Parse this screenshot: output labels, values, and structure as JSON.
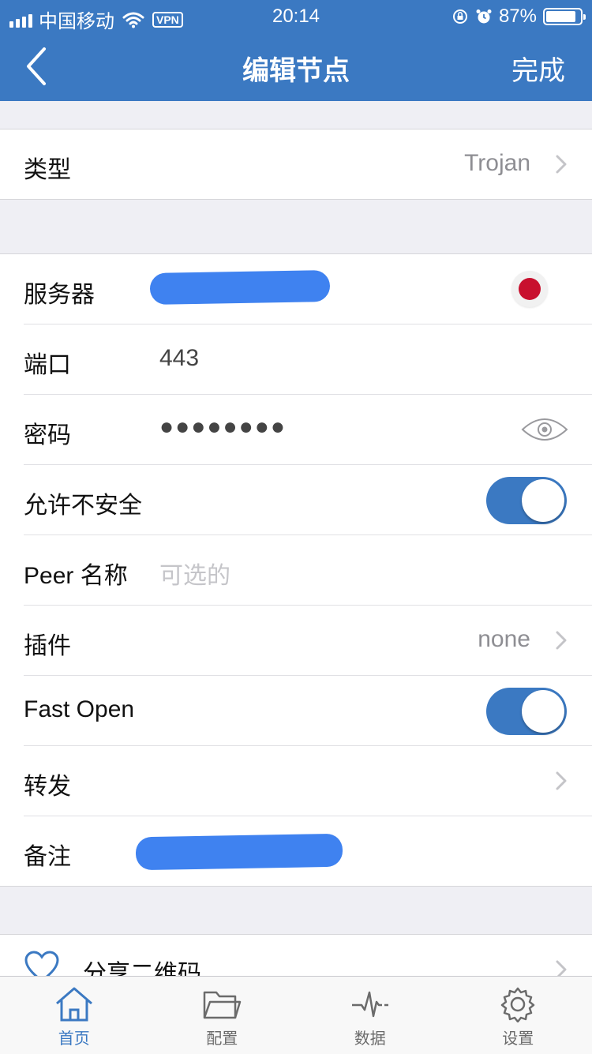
{
  "status_bar": {
    "carrier": "中国移动",
    "vpn": "VPN",
    "time": "20:14",
    "battery": "87%",
    "battery_level": 0.87
  },
  "nav": {
    "back_icon": "chevron-left-icon",
    "title": "编辑节点",
    "done": "完成"
  },
  "type_row": {
    "label": "类型",
    "value": "Trojan"
  },
  "form": {
    "server": {
      "label": "服务器"
    },
    "port": {
      "label": "端口",
      "value": "443"
    },
    "password": {
      "label": "密码",
      "value": "●●●●●●●●"
    },
    "allow_insecure": {
      "label": "允许不安全",
      "on": true
    },
    "peer_name": {
      "label": "Peer 名称",
      "placeholder": "可选的"
    },
    "plugin": {
      "label": "插件",
      "value": "none"
    },
    "fast_open": {
      "label": "Fast Open",
      "on": true
    },
    "forward": {
      "label": "转发"
    },
    "remark": {
      "label": "备注"
    }
  },
  "share": {
    "label": "分享二维码",
    "icon": "heart-icon"
  },
  "tabs": [
    {
      "label": "首页",
      "icon": "home-icon",
      "active": true
    },
    {
      "label": "配置",
      "icon": "folder-icon",
      "active": false
    },
    {
      "label": "数据",
      "icon": "pulse-icon",
      "active": false
    },
    {
      "label": "设置",
      "icon": "gear-icon",
      "active": false
    }
  ],
  "colors": {
    "accent": "#3b79c2",
    "redaction": "#3f82f0",
    "flag_red": "#c8102e"
  }
}
